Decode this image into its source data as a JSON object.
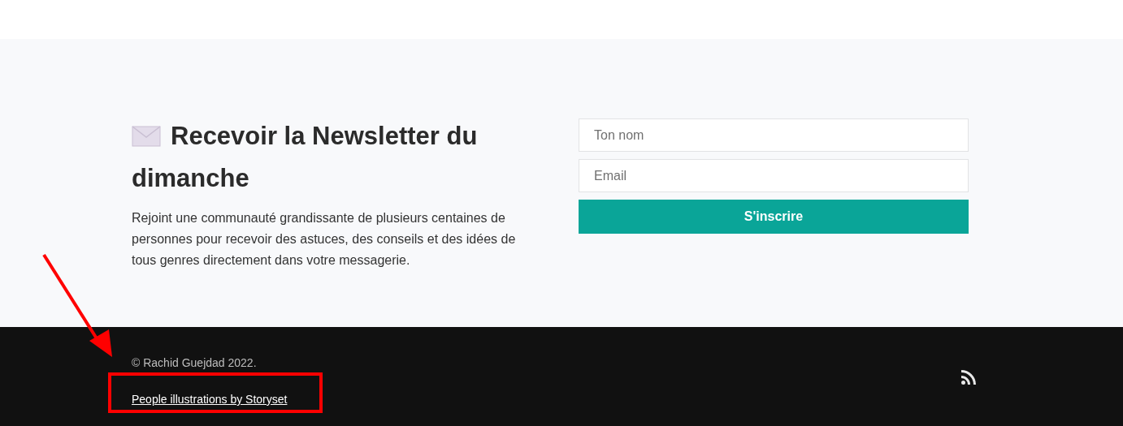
{
  "newsletter": {
    "title": "Recevoir la Newsletter du dimanche",
    "description": "Rejoint une communauté grandissante de plusieurs centaines de personnes pour recevoir des astuces, des conseils et des idées de tous genres directement dans votre messagerie.",
    "fields": [
      {
        "placeholder": "Ton nom"
      },
      {
        "placeholder": "Email"
      }
    ],
    "button": "S'inscrire"
  },
  "footer": {
    "copyright": "© Rachid Guejdad 2022.",
    "credit_link": "People illustrations by Storyset"
  }
}
